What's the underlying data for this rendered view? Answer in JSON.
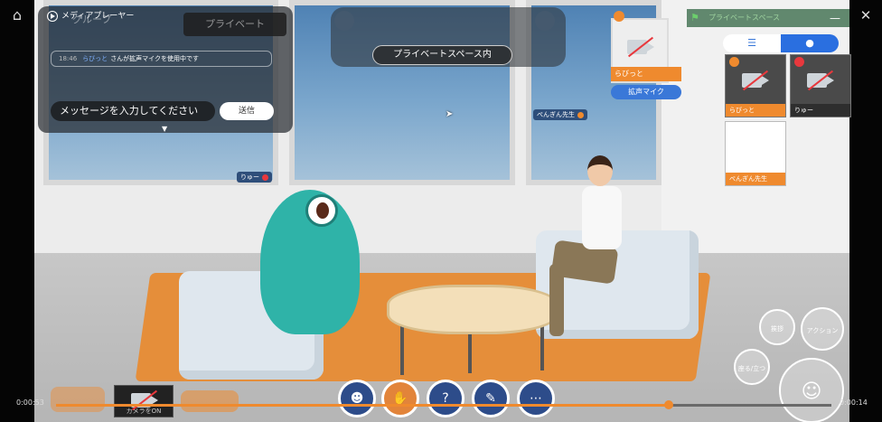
{
  "player": {
    "title": "メディアプレーヤー",
    "time_elapsed": "0:00:53",
    "time_remaining": "0:00:14",
    "progress": 0.79
  },
  "chat": {
    "tab_public": "グループ",
    "tab_private": "プライベート",
    "message": {
      "time": "18:46",
      "name": "らびっと",
      "text": "さんが拡声マイクを使用中です"
    },
    "input_placeholder": "メッセージを入力してください",
    "send_label": "送信"
  },
  "space": {
    "banner": "プライベートスペース内"
  },
  "speaker": {
    "name": "らびっと",
    "mic_badge": "拡声マイク"
  },
  "status_bar": {
    "label": "プライベートスペース"
  },
  "participants": [
    {
      "name": "らびっと",
      "badge_color": "#ef8a2e"
    },
    {
      "name": "りゅー",
      "badge_color": "#e8383d"
    },
    {
      "name": "ぺんぎん先生"
    }
  ],
  "avatars": {
    "ryu_tag": "りゅー",
    "pengin_tag": "ぺんぎん先生"
  },
  "actions": {
    "camera_label": "カメラをON",
    "greet": "挨拶",
    "action": "アクション",
    "sit": "座る/立つ"
  },
  "colors": {
    "accent": "#ef8a2e",
    "primary": "#2a6fe0",
    "danger": "#e8383d"
  }
}
